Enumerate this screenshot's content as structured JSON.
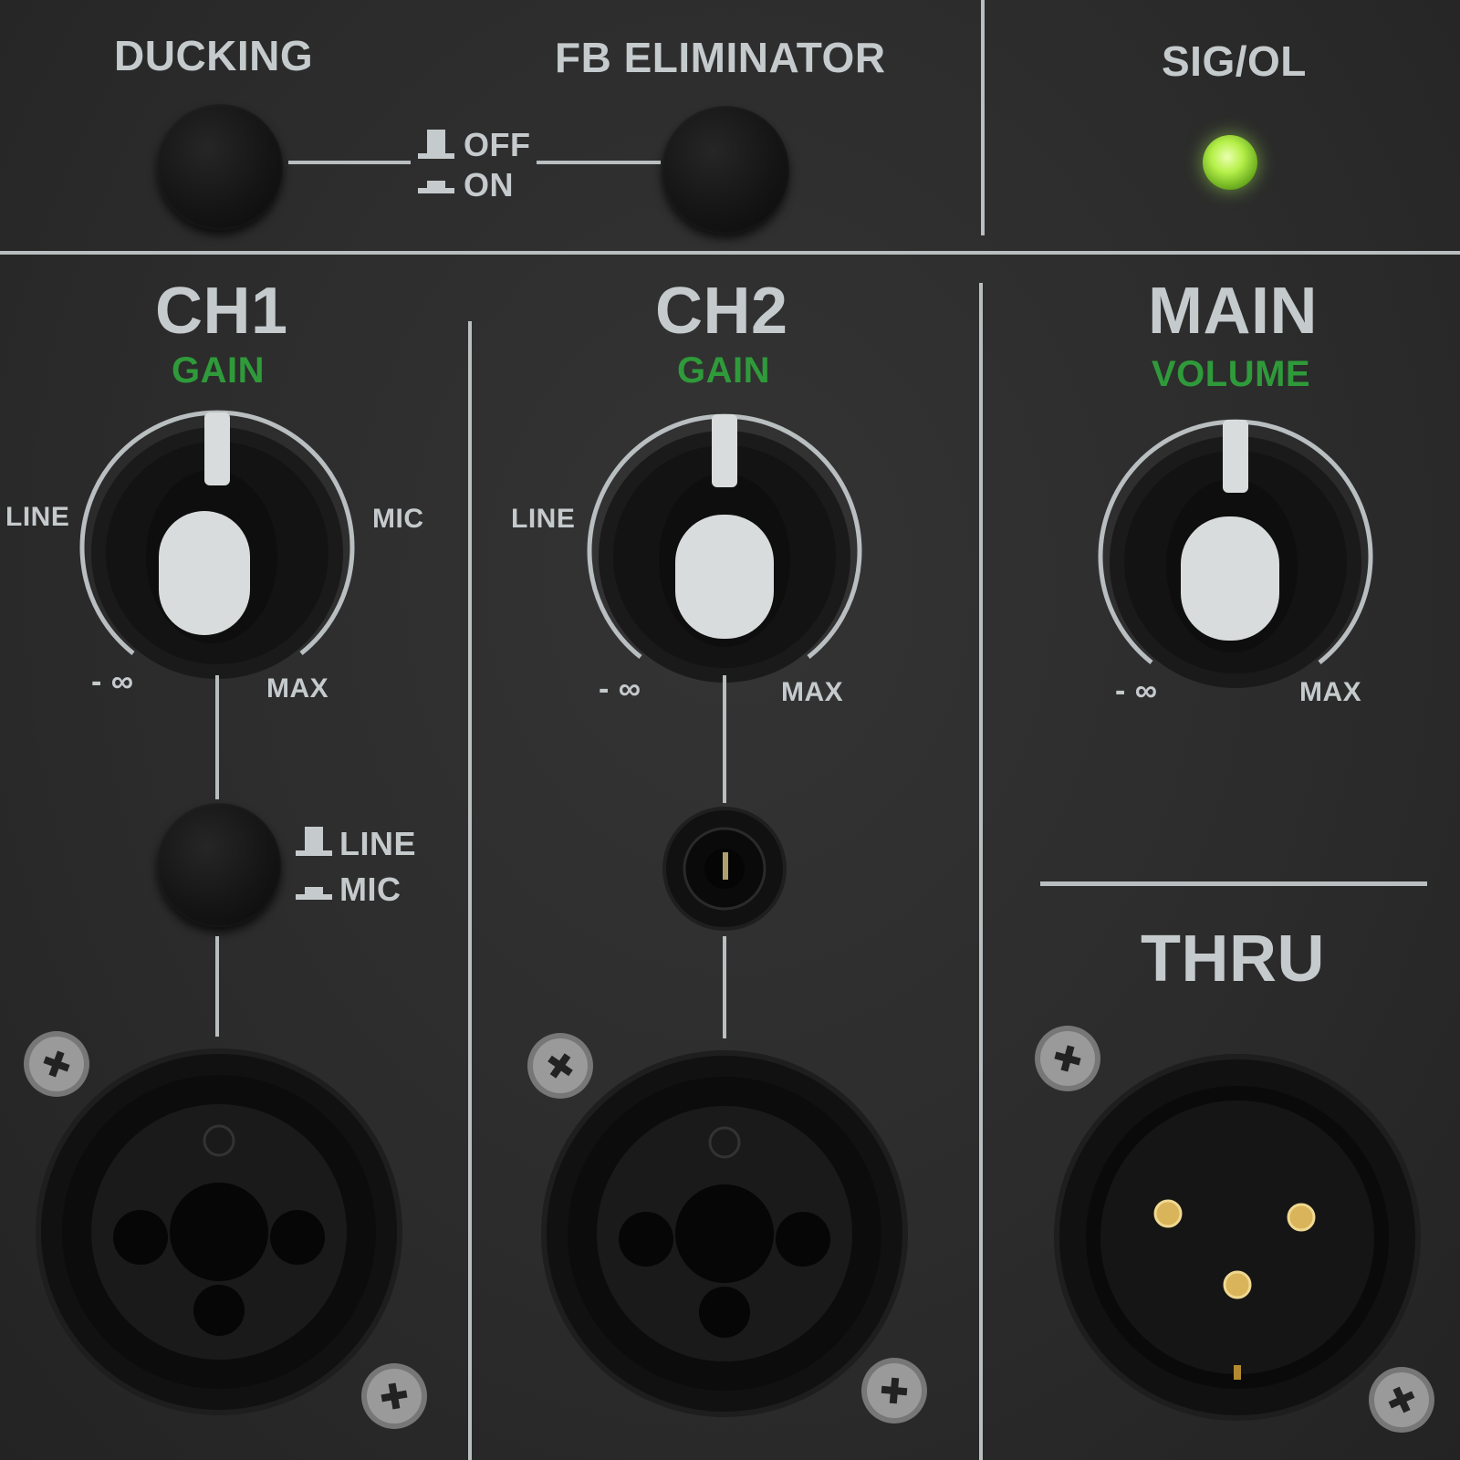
{
  "top": {
    "ducking_label": "DUCKING",
    "fb_label": "FB ELIMINATOR",
    "switch_off": "OFF",
    "switch_on": "ON",
    "sig_label": "SIG/OL",
    "led_color": "#b6f04a"
  },
  "ch1": {
    "title": "CH1",
    "gain_label": "GAIN",
    "line_side": "LINE",
    "mic_side": "MIC",
    "min_label": "- ∞",
    "max_label": "MAX",
    "switch_line": "LINE",
    "switch_mic": "MIC"
  },
  "ch2": {
    "title": "CH2",
    "gain_label": "GAIN",
    "line_side": "LINE",
    "min_label": "- ∞",
    "max_label": "MAX"
  },
  "main": {
    "title": "MAIN",
    "volume_label": "VOLUME",
    "min_label": "- ∞",
    "max_label": "MAX"
  },
  "thru": {
    "title": "THRU"
  },
  "colors": {
    "panel": "#2c2c2c",
    "text": "#c5cacc",
    "accent_green": "#2f9a3a",
    "knob_pointer": "#d9dcdc",
    "pin_gold": "#d9b45a"
  },
  "icons": [
    "screw-icon",
    "switch-up-icon",
    "switch-down-icon",
    "xlr-combo-jack-icon",
    "xlr-male-jack-icon",
    "quarter-inch-jack-icon"
  ]
}
